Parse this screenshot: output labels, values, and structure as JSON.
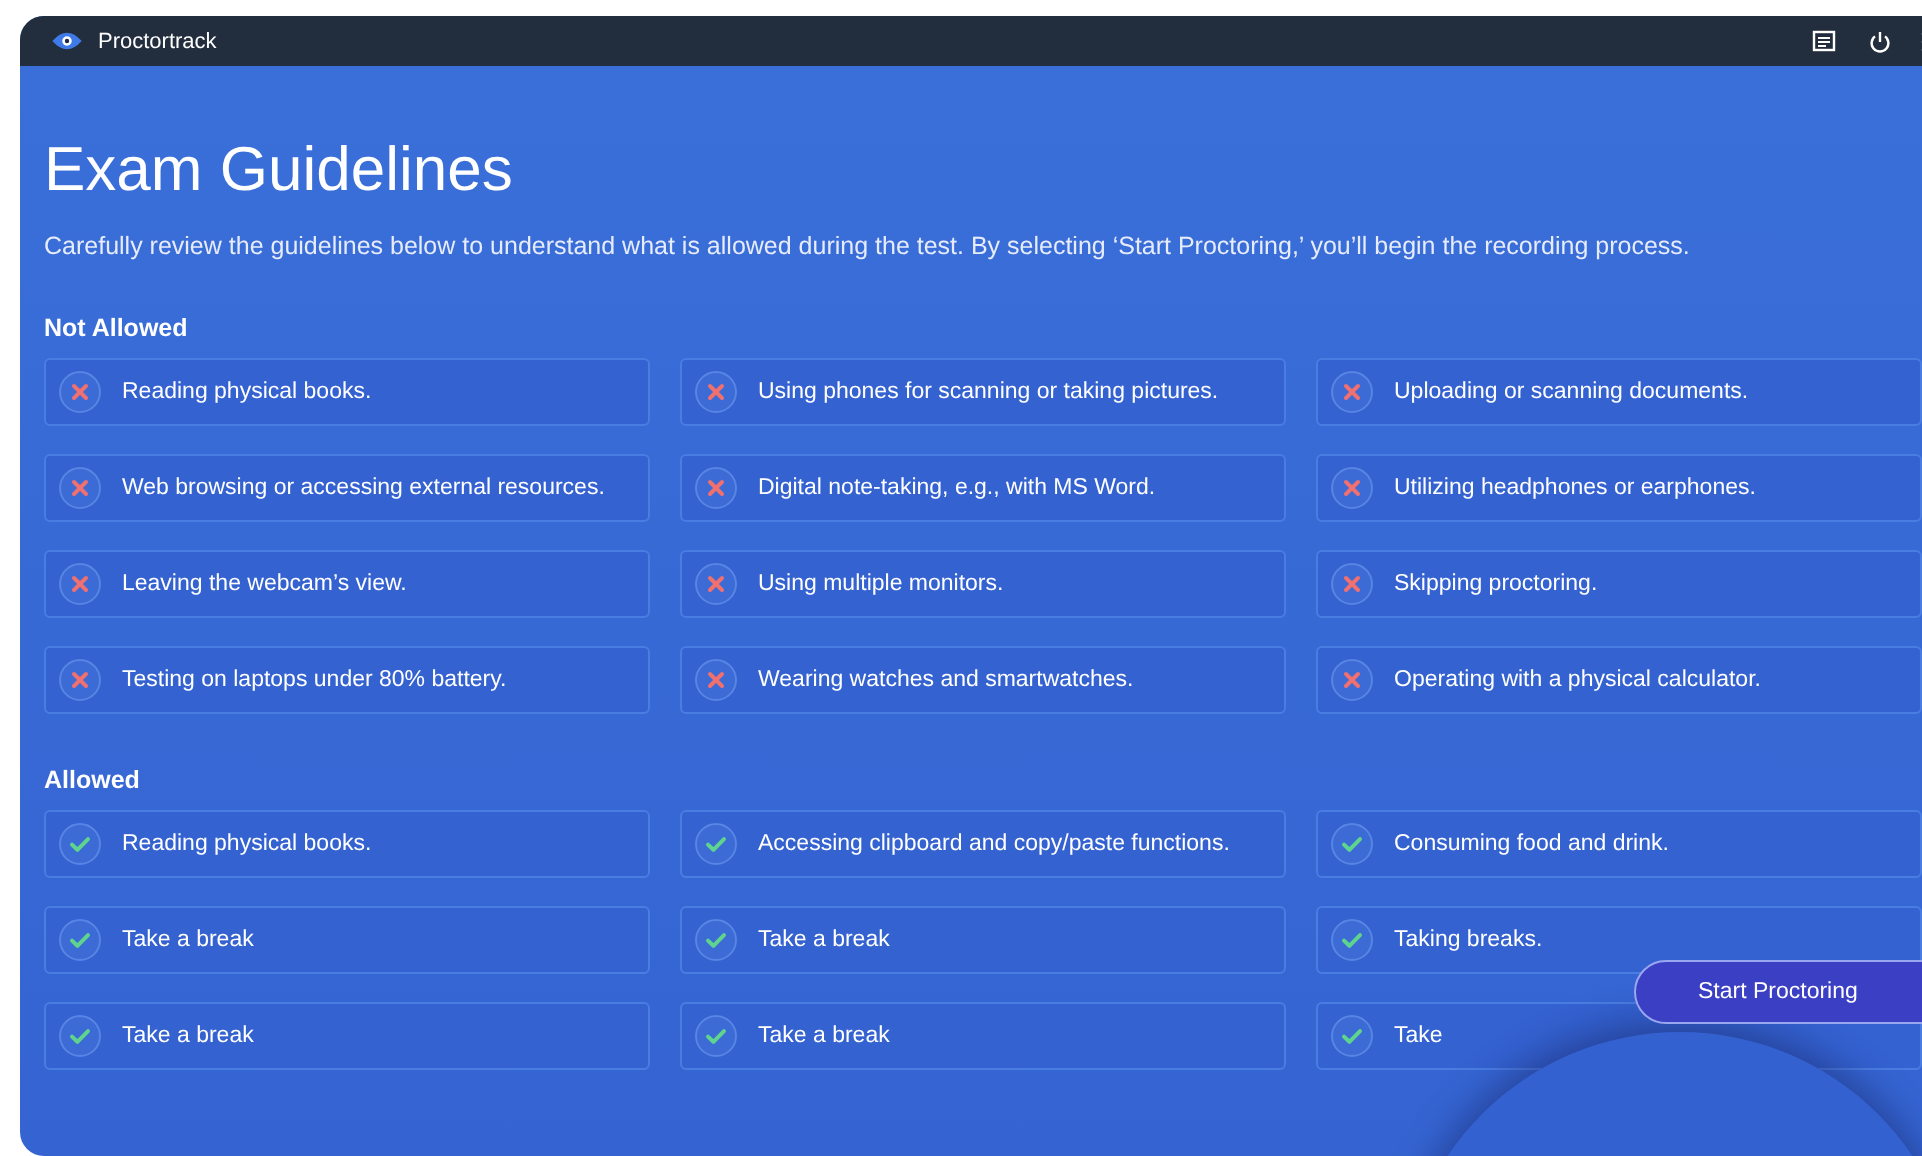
{
  "window": {
    "title": "Proctortrack"
  },
  "heading": "Exam Guidelines",
  "intro": "Carefully review the guidelines below to understand what is allowed during the test. By selecting ‘Start Proctoring,’ you’ll begin the recording process.",
  "sections": [
    {
      "title": "Not Allowed",
      "kind": "not_allowed",
      "items": [
        "Reading physical books.",
        "Using phones for scanning or taking pictures.",
        "Uploading or scanning documents.",
        "Web browsing or accessing external resources.",
        "Digital note-taking, e.g., with MS Word.",
        "Utilizing headphones or earphones.",
        "Leaving the webcam’s view.",
        "Using multiple monitors.",
        "Skipping proctoring.",
        "Testing on laptops under 80% battery.",
        "Wearing watches and smartwatches.",
        "Operating with a physical calculator."
      ]
    },
    {
      "title": "Allowed",
      "kind": "allowed",
      "items": [
        "Reading physical books.",
        "Accessing clipboard and copy/paste functions.",
        "Consuming food and drink.",
        "Take a break",
        "Take a break",
        "Taking breaks.",
        "Take a break",
        "Take a break",
        "Take"
      ]
    }
  ],
  "start_button": "Start Proctoring"
}
